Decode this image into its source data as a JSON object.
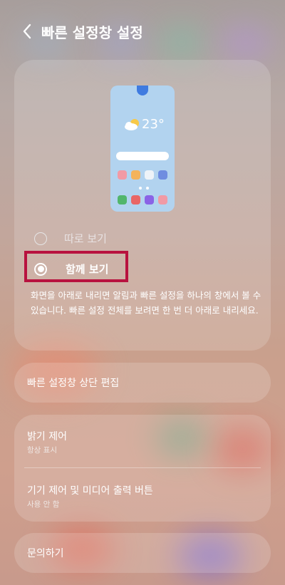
{
  "header": {
    "title": "빠른 설정창 설정"
  },
  "preview": {
    "temperature": "23°"
  },
  "options": [
    {
      "label": "따로 보기",
      "selected": false
    },
    {
      "label": "함께 보기",
      "selected": true
    }
  ],
  "description": "화면을 아래로 내리면 알림과 빠른 설정을 하나의 창에서 볼 수 있습니다. 빠른 설정 전체를 보려면 한 번 더 아래로 내리세요.",
  "menu": {
    "edit_top": "빠른 설정창 상단 편집",
    "brightness": {
      "title": "밝기 제어",
      "subtitle": "항상 표시"
    },
    "device_media": {
      "title": "기기 제어 및 미디어 출력 버튼",
      "subtitle": "사용 안 함"
    },
    "contact": "문의하기"
  },
  "colors": {
    "highlight": "#b8123f",
    "preview_bg": "#b2d3ef",
    "notch": "#3f7be0"
  }
}
